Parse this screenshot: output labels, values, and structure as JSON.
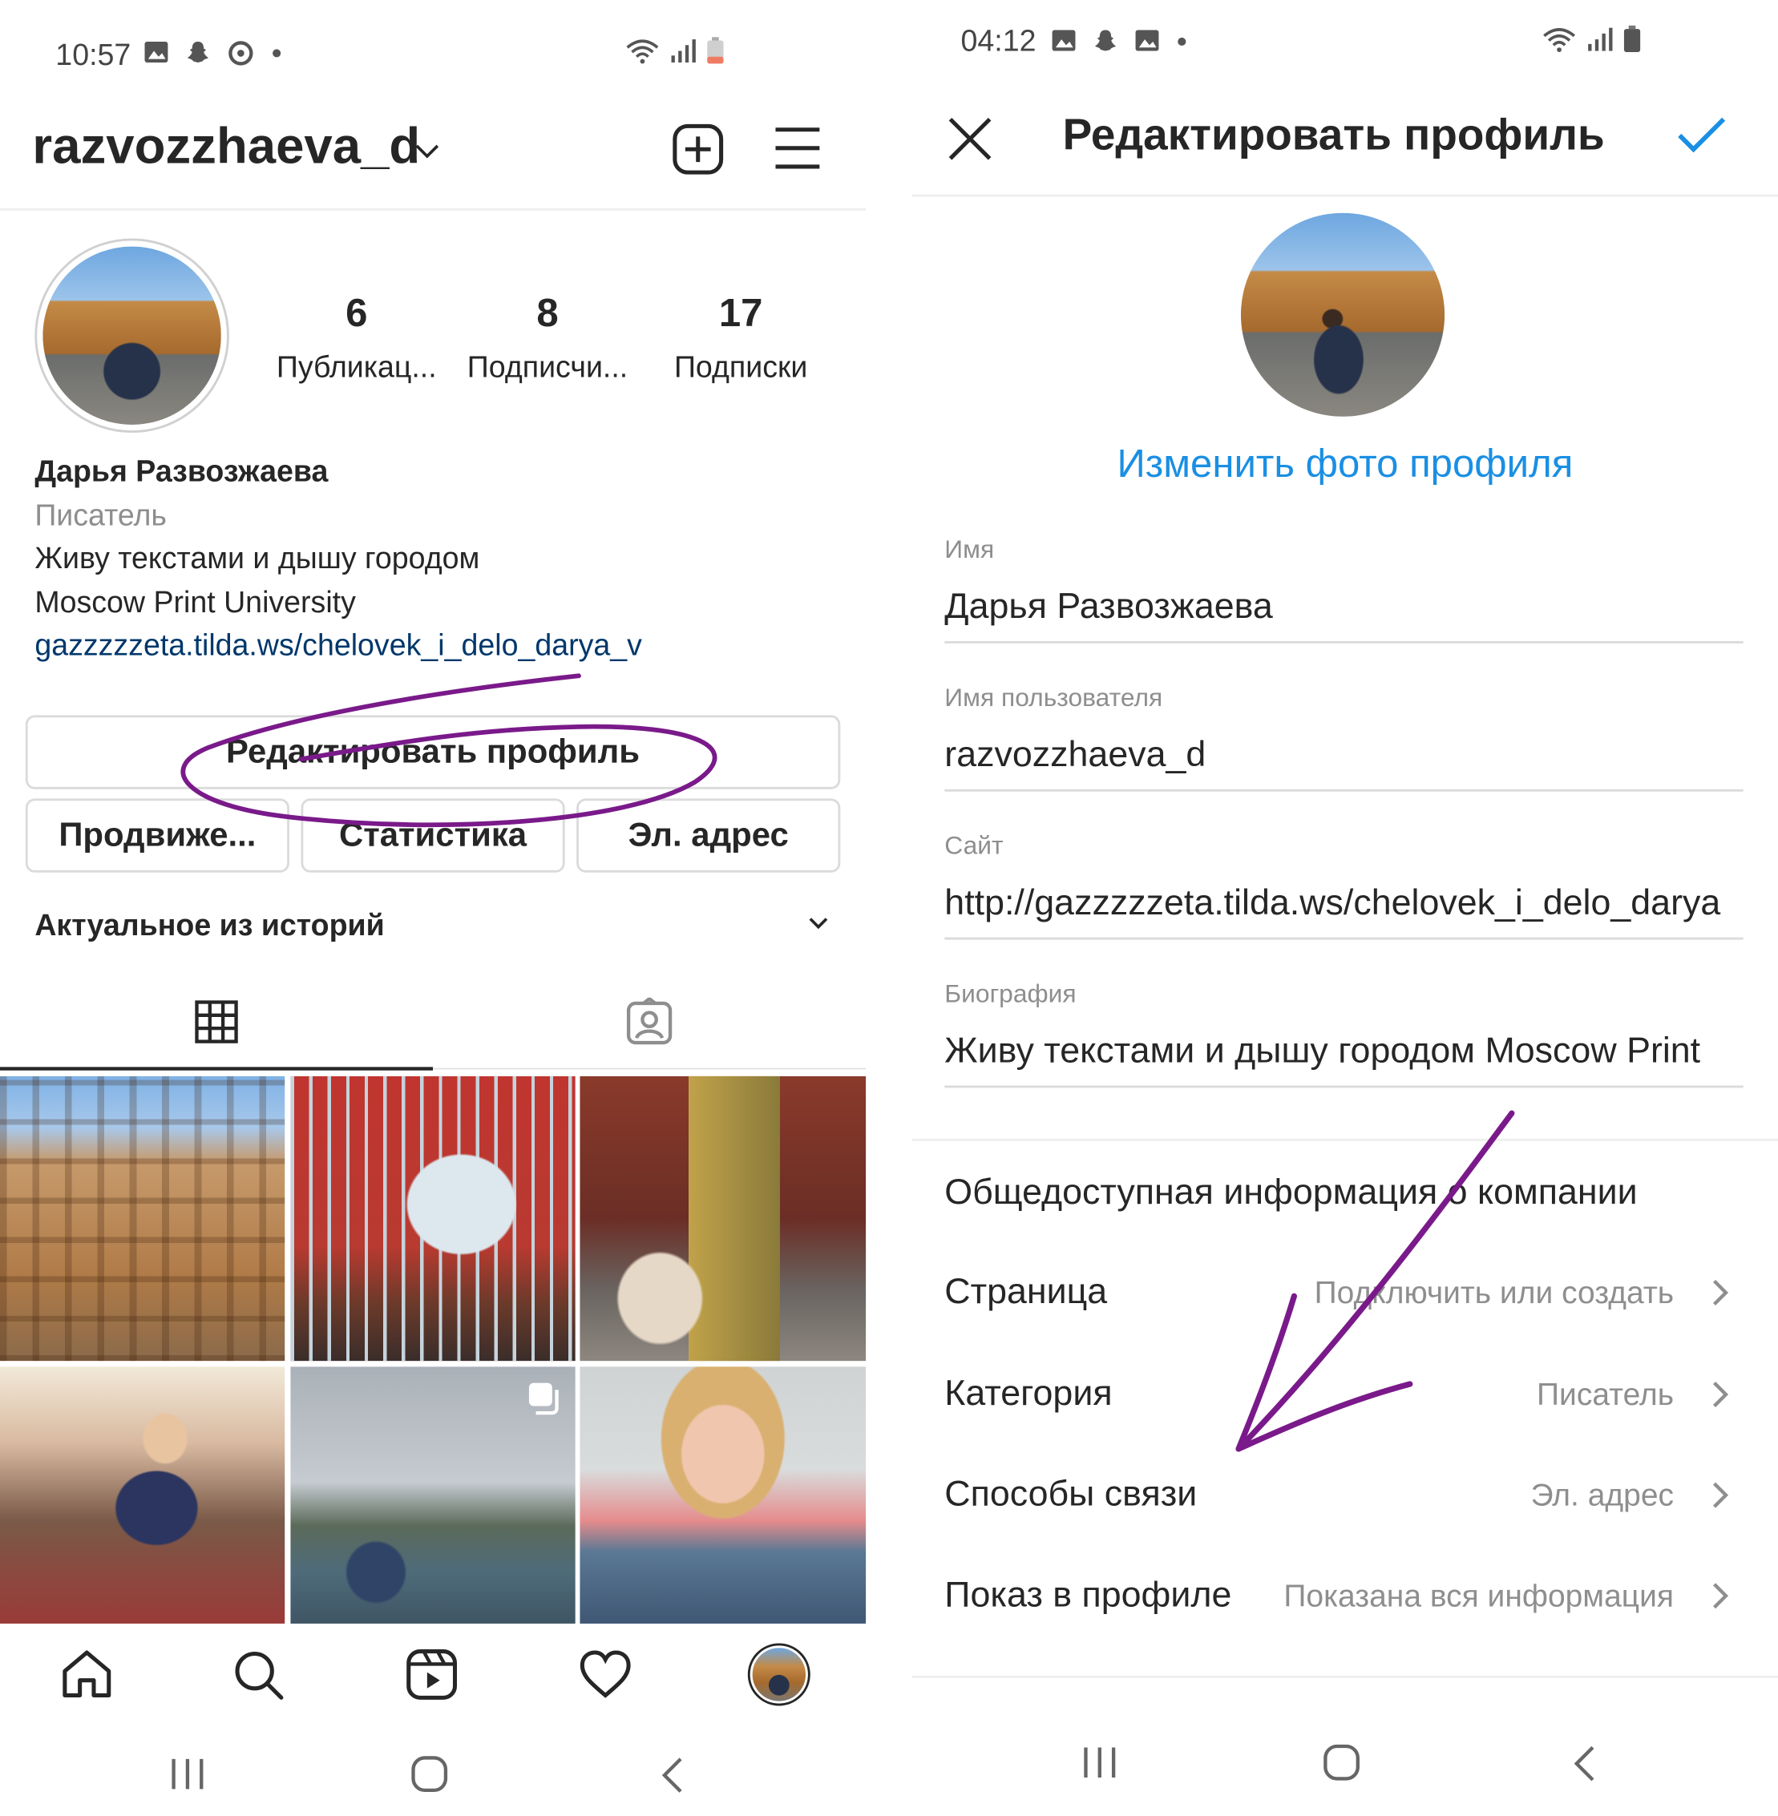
{
  "colors": {
    "accent_blue": "#1a8fe3",
    "link_blue": "#00376b",
    "annotation_purple": "#7a1a8a",
    "divider": "#dbdbdb"
  },
  "left": {
    "status": {
      "time": "10:57"
    },
    "header": {
      "username": "razvozzhaeva_d"
    },
    "stats": [
      {
        "count": "6",
        "label": "Публикац..."
      },
      {
        "count": "8",
        "label": "Подписчи..."
      },
      {
        "count": "17",
        "label": "Подписки"
      }
    ],
    "bio": {
      "name": "Дарья Развозжаева",
      "category": "Писатель",
      "line1": "Живу текстами и дышу городом",
      "line2": "Moscow Print University",
      "link": "gazzzzzeta.tilda.ws/chelovek_i_delo_darya_v"
    },
    "buttons": {
      "edit_profile": "Редактировать профиль",
      "promote": "Продвиже...",
      "stats": "Статистика",
      "email": "Эл. адрес"
    },
    "highlights": {
      "title": "Актуальное из историй"
    },
    "tabs": [
      "grid-icon",
      "tagged-icon"
    ],
    "bottom_nav": [
      "home-icon",
      "search-icon",
      "reels-icon",
      "heart-icon",
      "profile-avatar"
    ]
  },
  "right": {
    "status": {
      "time": "04:12"
    },
    "header": {
      "title": "Редактировать профиль"
    },
    "change_photo": "Изменить фото профиля",
    "fields": [
      {
        "label": "Имя",
        "value": "Дарья Развозжаева"
      },
      {
        "label": "Имя пользователя",
        "value": "razvozzhaeva_d"
      },
      {
        "label": "Сайт",
        "value": "http://gazzzzzeta.tilda.ws/chelovek_i_delo_darya"
      },
      {
        "label": "Биография",
        "value": "Живу текстами и дышу городом Moscow Print"
      }
    ],
    "business_section_title": "Общедоступная информация о компании",
    "rows": [
      {
        "title": "Страница",
        "value": "Подключить или создать"
      },
      {
        "title": "Категория",
        "value": "Писатель"
      },
      {
        "title": "Способы связи",
        "value": "Эл. адрес"
      },
      {
        "title": "Показ в профиле",
        "value": "Показана вся информация"
      }
    ]
  }
}
